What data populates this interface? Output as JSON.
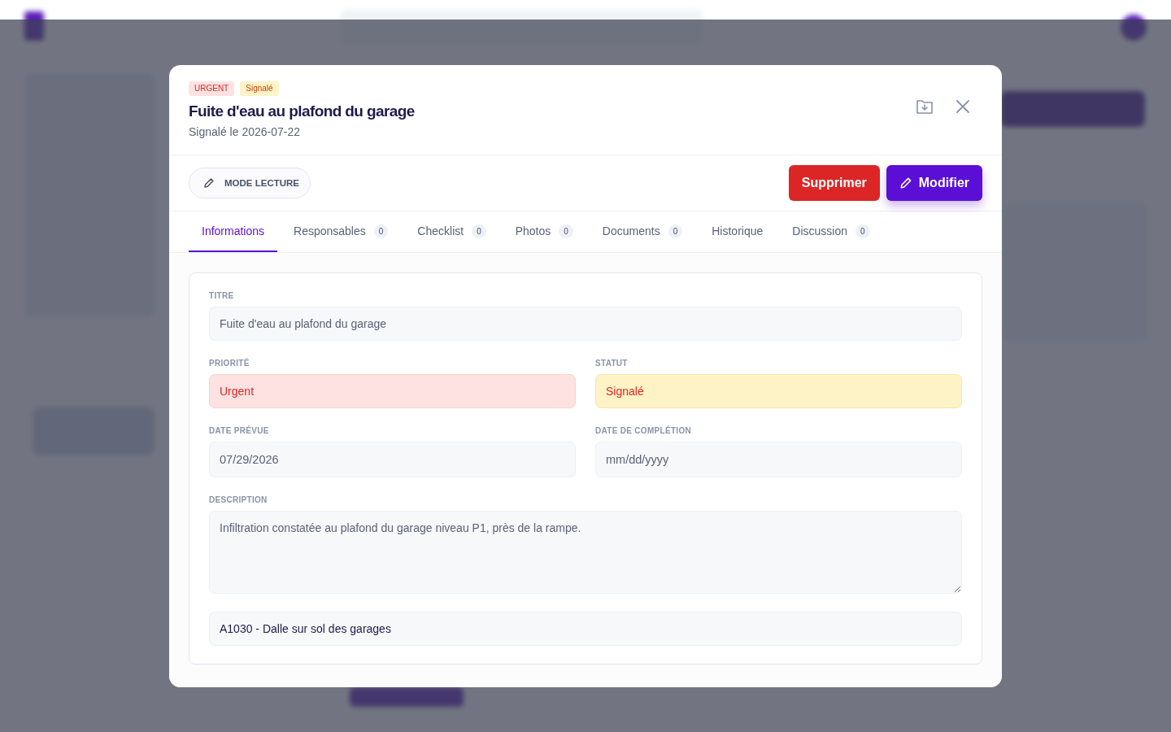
{
  "modal": {
    "badges": [
      {
        "label": "URGENT",
        "kind": "priority"
      },
      {
        "label": "Signalé",
        "kind": "status"
      }
    ],
    "title": "Fuite d'eau au plafond du garage",
    "subtitle": "Signalé le 2026-07-22",
    "mode_button": "MODE LECTURE",
    "actions": [
      {
        "label": "Supprimer",
        "kind": "danger"
      },
      {
        "label": "Modifier",
        "kind": "primary"
      }
    ],
    "tabs": [
      {
        "label": "Informations",
        "selected": true
      },
      {
        "label": "Responsables",
        "count": "0",
        "selected": false
      },
      {
        "label": "Checklist",
        "count": "0",
        "selected": false
      },
      {
        "label": "Photos",
        "count": "0",
        "selected": false
      },
      {
        "label": "Documents",
        "count": "0",
        "selected": false
      },
      {
        "label": "Historique",
        "selected": false
      },
      {
        "label": "Discussion",
        "count": "0",
        "selected": false
      }
    ],
    "fields": [
      {
        "kind": "text",
        "label": "TITRE",
        "value": "Fuite d'eau au plafond du garage"
      },
      {
        "kind": "priority",
        "label": "PRIORITÉ",
        "value": "Urgent"
      },
      {
        "kind": "status",
        "label": "STATUT",
        "value": "Signalé"
      },
      {
        "kind": "date",
        "label": "DATE PRÉVUE",
        "value": "07/29/2026"
      },
      {
        "kind": "date",
        "label": "DATE DE COMPLÉTION",
        "placeholder": "mm/dd/yyyy"
      },
      {
        "kind": "textarea",
        "label": "DESCRIPTION",
        "value": "Infiltration constatée au plafond du garage niveau P1, près de la rampe."
      },
      {
        "kind": "select",
        "value": "A1030 - Dalle sur sol des garages"
      }
    ]
  }
}
